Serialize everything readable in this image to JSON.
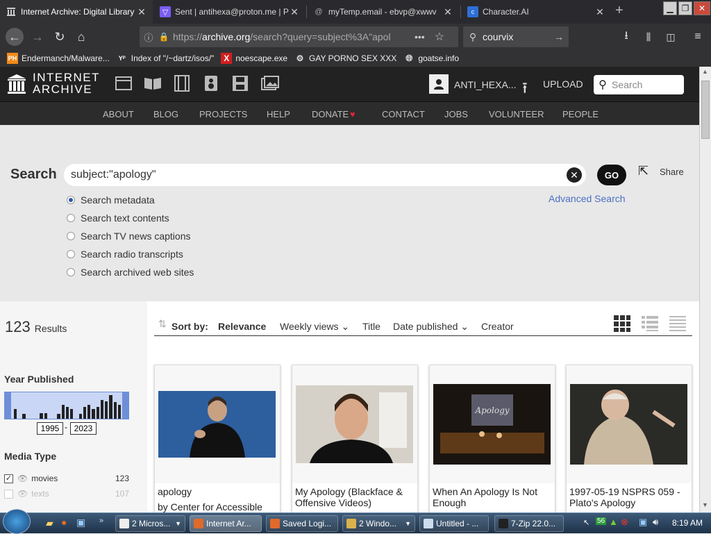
{
  "browser": {
    "tabs": [
      {
        "title": "Internet Archive: Digital Library",
        "active": true
      },
      {
        "title": "Sent | antihexa@proton.me | P",
        "active": false
      },
      {
        "title": "myTemp.email - ebvp@xwwv",
        "active": false
      },
      {
        "title": "Character.AI",
        "active": false
      }
    ],
    "url_prefix": "https://",
    "url_domain": "archive.org",
    "url_path": "/search?query=subject%3A\"apol",
    "url_dots": "•••",
    "search_value": "courvix",
    "bookmarks": [
      {
        "label": "Endermanch/Malware...",
        "icon": "PH"
      },
      {
        "label": "Index of \"/~dartz/isos/\"",
        "icon": "Y"
      },
      {
        "label": "noescape.exe",
        "icon": "X"
      },
      {
        "label": "GAY PORNO SEX XXX",
        "icon": "gear"
      },
      {
        "label": "goatse.info",
        "icon": "globe"
      }
    ]
  },
  "ia": {
    "logo_line1": "INTERNET",
    "logo_line2": "ARCHIVE",
    "user": "ANTI_HEXA...",
    "upload": "UPLOAD",
    "search_placeholder": "Search",
    "menu": [
      "ABOUT",
      "BLOG",
      "PROJECTS",
      "HELP",
      "DONATE",
      "CONTACT",
      "JOBS",
      "VOLUNTEER",
      "PEOPLE"
    ],
    "search_label": "Search",
    "query": "subject:\"apology\"",
    "go": "GO",
    "share": "Share",
    "advanced": "Advanced Search",
    "options": [
      {
        "label": "Search metadata",
        "checked": true
      },
      {
        "label": "Search text contents",
        "checked": false
      },
      {
        "label": "Search TV news captions",
        "checked": false
      },
      {
        "label": "Search radio transcripts",
        "checked": false
      },
      {
        "label": "Search archived web sites",
        "checked": false
      }
    ],
    "results_count": "123",
    "results_word": "Results",
    "sort_label": "Sort by:",
    "sort_options": [
      "Relevance",
      "Weekly views",
      "Title",
      "Date published",
      "Creator"
    ],
    "year_heading": "Year Published",
    "year_from": "1995",
    "year_to": "2023",
    "year_dash": "-",
    "histogram": [
      0.4,
      0,
      0.2,
      0,
      0,
      0,
      0.25,
      0.25,
      0,
      0,
      0.2,
      0.6,
      0.5,
      0.4,
      0,
      0.2,
      0.5,
      0.6,
      0.4,
      0.5,
      0.8,
      0.75,
      1.0,
      0.7,
      0.6
    ],
    "media_heading": "Media Type",
    "media": [
      {
        "label": "movies",
        "count": "123",
        "checked": true
      },
      {
        "label": "texts",
        "count": "107",
        "checked": false
      }
    ],
    "cards": [
      {
        "title": "apology",
        "subtitle": "by Center for Accessible",
        "thumb": "#2d5e9e"
      },
      {
        "title": "My Apology (Blackface & Offensive Videos)",
        "subtitle": "",
        "thumb": "#d6d1c8"
      },
      {
        "title": "When An Apology Is Not Enough",
        "subtitle": "",
        "thumb": "#1a1410"
      },
      {
        "title": "1997-05-19 NSPRS 059 - Plato's Apology",
        "subtitle": "",
        "thumb": "#2a2a26"
      }
    ]
  },
  "taskbar": {
    "items": [
      {
        "label": "2 Micros...",
        "active": false
      },
      {
        "label": "Internet Ar...",
        "active": true
      },
      {
        "label": "Saved Logi...",
        "active": false
      },
      {
        "label": "2 Windo...",
        "active": false
      },
      {
        "label": "Untitled - ...",
        "active": false
      },
      {
        "label": "7-Zip 22.0...",
        "active": false
      }
    ],
    "tray_badge": "56",
    "clock": "8:19 AM"
  },
  "colors": {
    "ia_bg": "#222222",
    "link": "#4b6fc4",
    "donate_heart": "#e0223b"
  }
}
